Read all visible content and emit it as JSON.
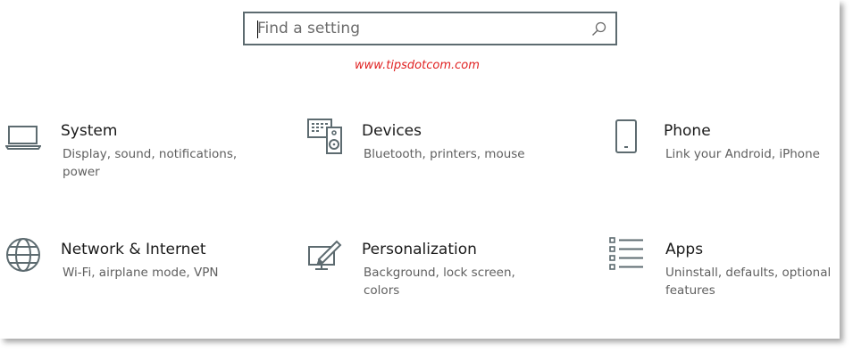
{
  "search": {
    "placeholder": "Find a setting",
    "value": ""
  },
  "watermark": "www.tipsdotcom.com",
  "tiles": [
    {
      "icon": "laptop-icon",
      "title": "System",
      "description": "Display, sound, notifications, power"
    },
    {
      "icon": "devices-icon",
      "title": "Devices",
      "description": "Bluetooth, printers, mouse"
    },
    {
      "icon": "phone-icon",
      "title": "Phone",
      "description": "Link your Android, iPhone"
    },
    {
      "icon": "globe-icon",
      "title": "Network & Internet",
      "description": "Wi-Fi, airplane mode, VPN"
    },
    {
      "icon": "personalization-icon",
      "title": "Personalization",
      "description": "Background, lock screen, colors"
    },
    {
      "icon": "apps-list-icon",
      "title": "Apps",
      "description": "Uninstall, defaults, optional features"
    }
  ],
  "colors": {
    "icon": "#5d6b70",
    "watermark": "#e02020",
    "title": "#1a1a1a",
    "description": "#5f5f5f"
  }
}
